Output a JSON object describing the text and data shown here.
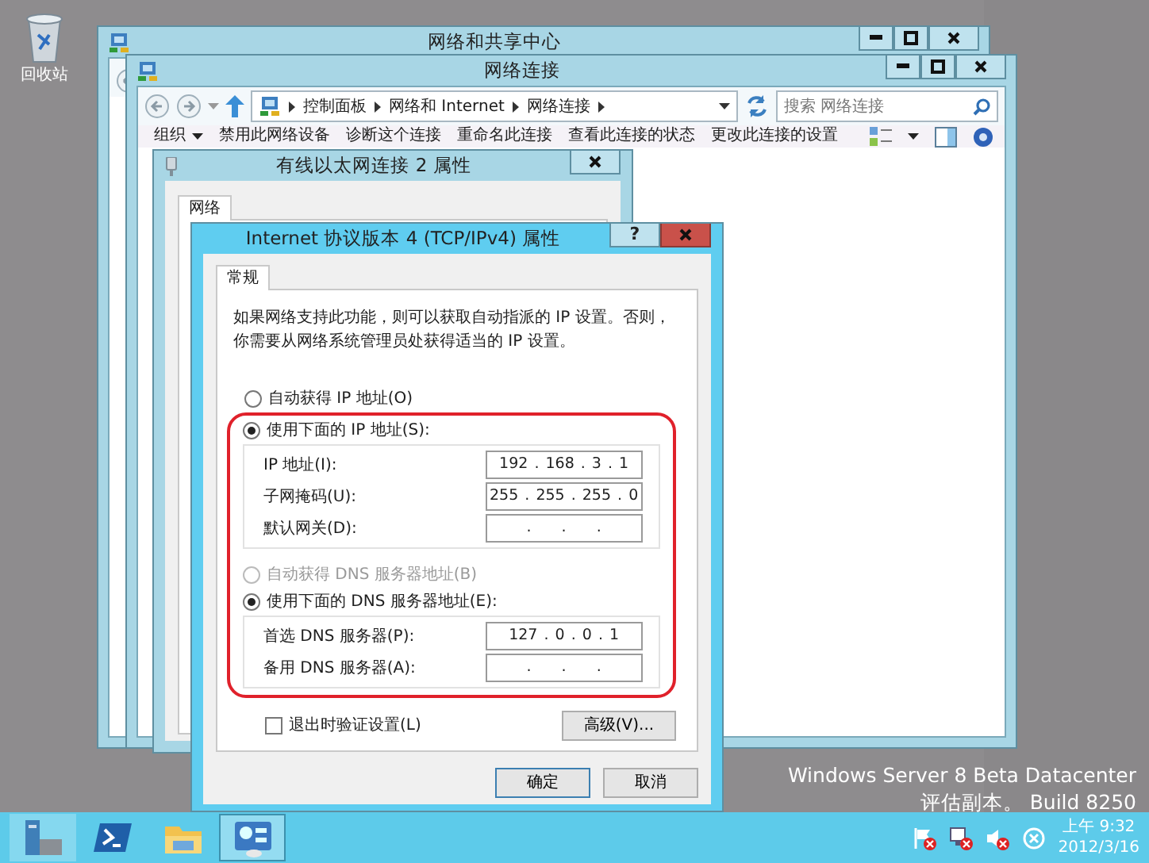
{
  "desktop": {
    "icons": [
      {
        "label": "回收站"
      }
    ]
  },
  "sharing_center": {
    "title": "网络和共享中心"
  },
  "connections": {
    "title": "网络连接",
    "breadcrumbs": [
      "控制面板",
      "网络和 Internet",
      "网络连接"
    ],
    "search": {
      "placeholder": "搜索 网络连接"
    },
    "toolbar": [
      {
        "label": "组织",
        "menu": true
      },
      {
        "label": "禁用此网络设备",
        "menu": false
      },
      {
        "label": "诊断这个连接",
        "menu": false
      },
      {
        "label": "重命名此连接",
        "menu": false
      },
      {
        "label": "查看此连接的状态",
        "menu": false
      },
      {
        "label": "更改此连接的设置",
        "menu": false
      }
    ]
  },
  "adapter_properties": {
    "title": "有线以太网连接 2 属性",
    "tabs": [
      {
        "label": "网络",
        "selected": true
      }
    ]
  },
  "ipv4": {
    "title": "Internet 协议版本 4 (TCP/IPv4) 属性",
    "help_button": "?",
    "tabs": [
      {
        "label": "常规",
        "selected": true
      }
    ],
    "description": "如果网络支持此功能，则可以获取自动指派的 IP 设置。否则，你需要从网络系统管理员处获得适当的 IP 设置。",
    "ip_options": [
      {
        "label": "自动获得 IP 地址(O)",
        "selected": false,
        "disabled": false
      },
      {
        "label": "使用下面的 IP 地址(S):",
        "selected": true,
        "disabled": false
      }
    ],
    "ip_fields": [
      {
        "label": "IP 地址(I):",
        "value": "192 . 168 . 3 . 1"
      },
      {
        "label": "子网掩码(U):",
        "value": "255 . 255 . 255 . 0"
      },
      {
        "label": "默认网关(D):",
        "value": ". . ."
      }
    ],
    "dns_options": [
      {
        "label": "自动获得 DNS 服务器地址(B)",
        "selected": false,
        "disabled": true
      },
      {
        "label": "使用下面的 DNS 服务器地址(E):",
        "selected": true,
        "disabled": false
      }
    ],
    "dns_fields": [
      {
        "label": "首选 DNS 服务器(P):",
        "value": "127 . 0 . 0 . 1"
      },
      {
        "label": "备用 DNS 服务器(A):",
        "value": ". . ."
      }
    ],
    "validate": {
      "label": "退出时验证设置(L)",
      "checked": false
    },
    "advanced_button": "高级(V)...",
    "buttons": [
      "确定",
      "取消"
    ]
  },
  "desktop_notice": {
    "edition": "Windows Server 8 Beta Datacenter",
    "build": "评估副本。 Build 8250"
  },
  "taskbar": {
    "apps": [
      {
        "kind": "server",
        "selected": false
      },
      {
        "kind": "powershell",
        "selected": false
      },
      {
        "kind": "explorer",
        "selected": false
      },
      {
        "kind": "network",
        "selected": true
      }
    ],
    "clock": {
      "time": "上午 9:32",
      "date": "2012/3/16"
    }
  }
}
